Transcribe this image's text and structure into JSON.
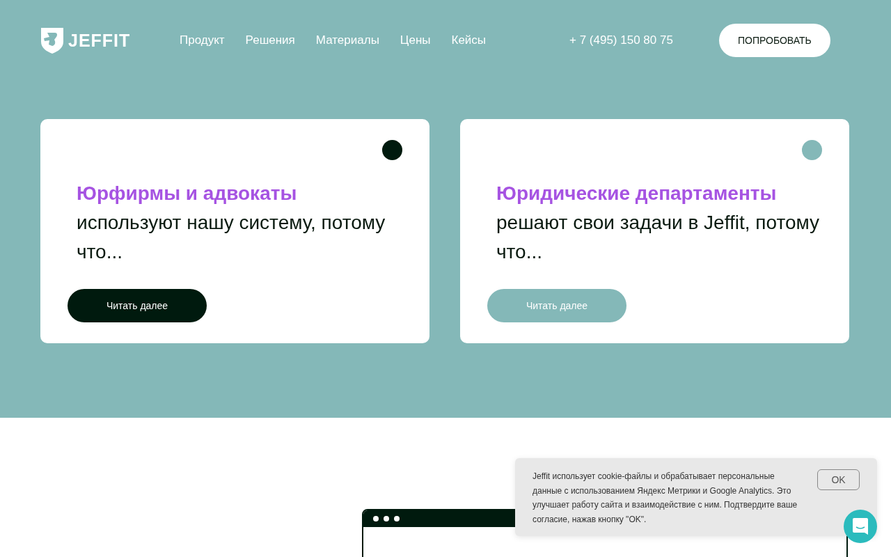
{
  "header": {
    "logo": "JEFFIT",
    "nav": [
      {
        "label": "Продукт"
      },
      {
        "label": "Решения"
      },
      {
        "label": "Материалы"
      },
      {
        "label": "Цены"
      },
      {
        "label": "Кейсы"
      }
    ],
    "phone": "+ 7 (495) 150 80 75",
    "cta": "ПОПРОБОВАТЬ"
  },
  "cards": [
    {
      "highlight": "Юрфирмы и адвокаты",
      "text": "используют нашу систему, потому что...",
      "button": "Читать далее",
      "active": true
    },
    {
      "highlight": "Юридические департаменты",
      "text": "решают свои задачи в Jeffit, потому что...",
      "button": "Читать далее",
      "active": false
    }
  ],
  "cookie": {
    "text": "Jeffit использует cookie-файлы и обрабатывает персональные данные с использованием Яндекс Метрики и Google Analytics. Это улучшает работу сайта и взаимодействие с ним. Подтвердите ваше согласие, нажав кнопку \"OK\".",
    "button": "OK"
  }
}
